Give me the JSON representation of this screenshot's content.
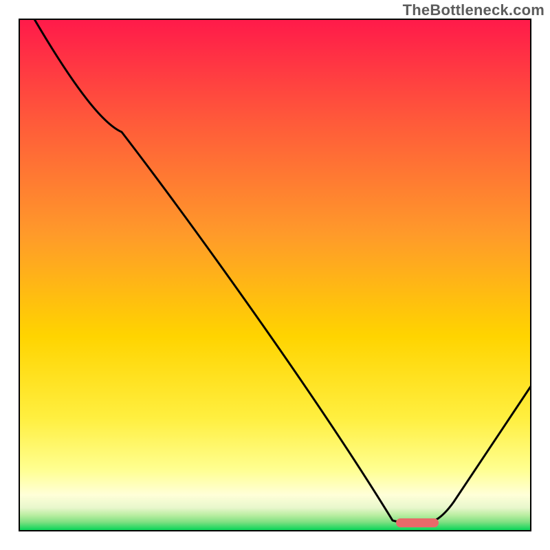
{
  "watermark": "TheBottleneck.com",
  "chart_data": {
    "type": "line",
    "title": "",
    "xlabel": "",
    "ylabel": "",
    "xlim": [
      0,
      100
    ],
    "ylim": [
      0,
      100
    ],
    "grid": false,
    "legend": false,
    "background_gradient": {
      "top": "#ff1a4a",
      "mid_upper": "#ff8a2a",
      "mid": "#ffd400",
      "mid_lower": "#ffff55",
      "lower": "#ffffc0",
      "band_pale_green": "#d9f5c2",
      "bottom": "#00d455"
    },
    "series": [
      {
        "name": "bottleneck-curve",
        "x": [
          3,
          20,
          73,
          80,
          100
        ],
        "y": [
          100,
          78,
          2,
          2,
          28
        ],
        "note": "y is percent from chart bottom; curve descends nearly linearly from top-left, has slight knee near x≈20, hits a flat minimum around x≈73–80, then rises to the right edge.",
        "stroke": "#000000",
        "stroke_width": 3
      }
    ],
    "marker": {
      "name": "optimal-range-marker",
      "x_start": 74,
      "x_end": 82,
      "y": 2,
      "color": "#e86a6a",
      "shape": "rounded-bar"
    }
  }
}
